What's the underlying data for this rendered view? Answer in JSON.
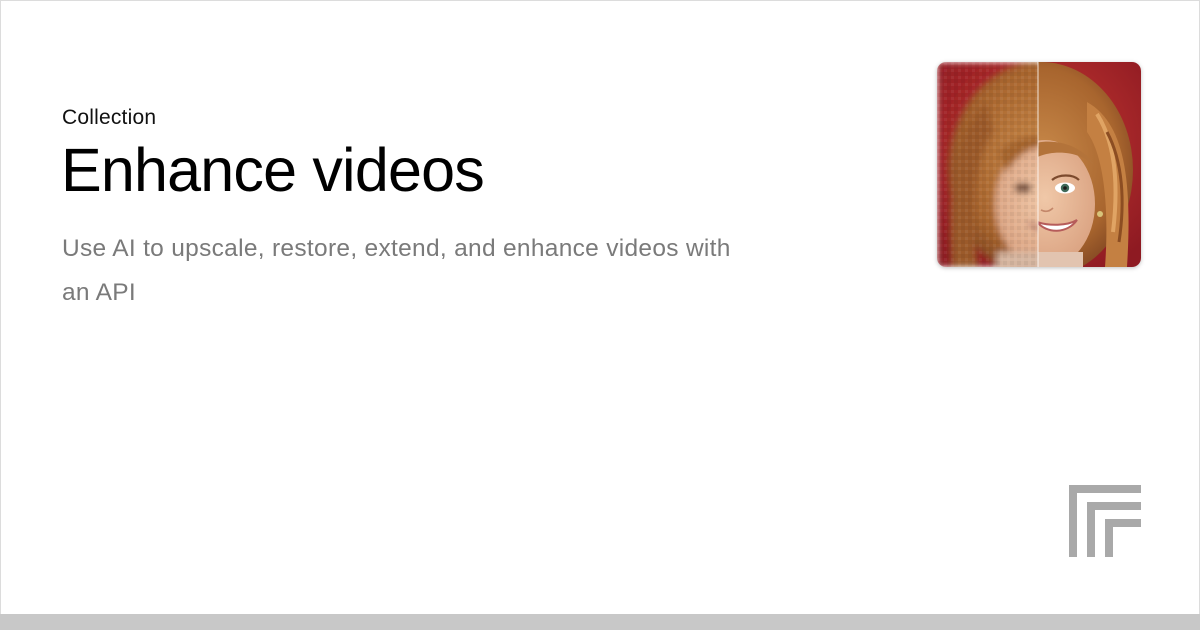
{
  "collection_label": "Collection",
  "title": "Enhance videos",
  "description": "Use AI to upscale, restore, extend, and enhance videos with an API",
  "thumbnail": {
    "icon": "before-after-face-image",
    "colors": {
      "background": "#b3242a",
      "hair": "#b8743a",
      "skin": "#e7b99a"
    }
  },
  "logo": {
    "icon": "replicate-logo-icon",
    "color": "#a9a9a9"
  },
  "colors": {
    "title": "#000000",
    "description": "#7a7a7a",
    "bottom_bar": "#c8c8c8"
  }
}
